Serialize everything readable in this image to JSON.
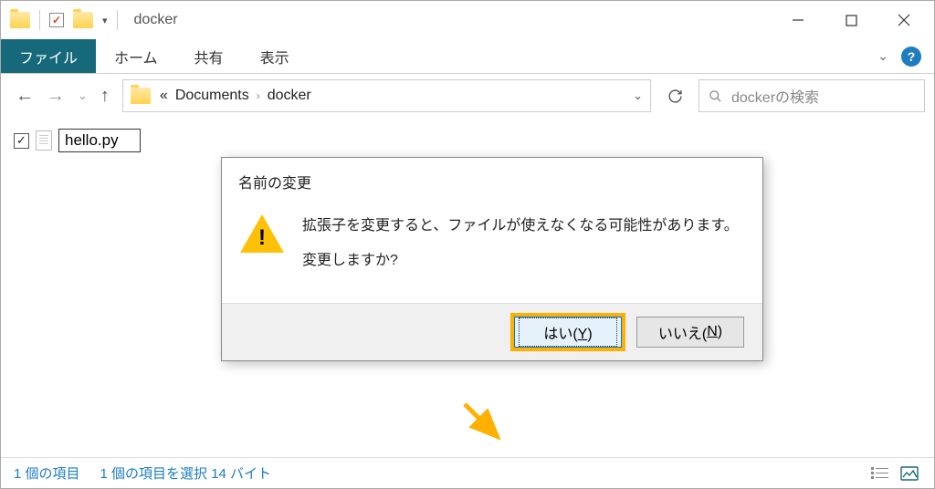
{
  "titlebar": {
    "title": "docker"
  },
  "ribbon": {
    "file": "ファイル",
    "home": "ホーム",
    "share": "共有",
    "view": "表示"
  },
  "nav": {
    "path_prefix": "«",
    "path_parent": "Documents",
    "path_current": "docker"
  },
  "search": {
    "placeholder": "dockerの検索"
  },
  "file_item": {
    "name": "hello.py"
  },
  "dialog": {
    "title": "名前の変更",
    "message_line1": "拡張子を変更すると、ファイルが使えなくなる可能性があります。",
    "message_line2": "変更しますか?",
    "yes_prefix": "はい(",
    "yes_key": "Y",
    "yes_suffix": ")",
    "no_prefix": "いいえ(",
    "no_key": "N",
    "no_suffix": ")"
  },
  "statusbar": {
    "count": "1 個の項目",
    "selection": "1 個の項目を選択 14 バイト"
  }
}
